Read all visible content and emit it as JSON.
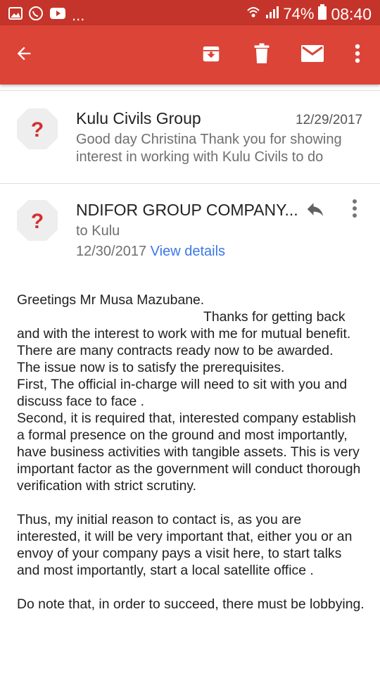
{
  "status_bar": {
    "dots": "...",
    "battery": "74%",
    "time": "08:40",
    "icons": [
      "gallery-icon",
      "whatsapp-icon",
      "youtube-icon",
      "wifi-icon",
      "signal-icon",
      "battery-icon"
    ]
  },
  "app_bar": {
    "icons": [
      "back-arrow-icon",
      "archive-icon",
      "delete-icon",
      "mail-icon",
      "more-vert-icon"
    ]
  },
  "colors": {
    "status_bar": "#c5342a",
    "app_bar": "#db4437",
    "avatar": "#d32f2f",
    "link": "#3b78e7"
  },
  "message1": {
    "sender": "Kulu Civils Group",
    "date": "12/29/2017",
    "snippet": "Good day Christina Thank you for showing interest in working with Kulu Civils to do",
    "avatar_char": "?"
  },
  "message2": {
    "sender": "NDIFOR GROUP COMPANY...",
    "to": "to Kulu",
    "date": "12/30/2017",
    "view_details": "View details",
    "avatar_char": "?"
  },
  "body": {
    "greeting": "Greetings Mr Musa Mazubane.",
    "p1a": "Thanks for getting back",
    "p1b": "and with the interest to work with me for mutual benefit.",
    "p2": "There are many contracts ready now to be awarded.",
    "p3": "The issue now is to satisfy the prerequisites.",
    "p4": "First, The official in-charge will need to sit with you and discuss face to face .",
    "p5": "Second, it is required that, interested company establish a formal presence on the ground and most importantly, have business activities with tangible assets. This is very important factor as the government will conduct thorough verification with strict scrutiny.",
    "p6": "Thus, my initial reason to contact is, as you are interested, it will be very important that, either you or an envoy of your company pays a visit here, to start talks and most importantly, start a local satellite office .",
    "p7": "Do note that, in order to succeed, there must be lobbying."
  }
}
